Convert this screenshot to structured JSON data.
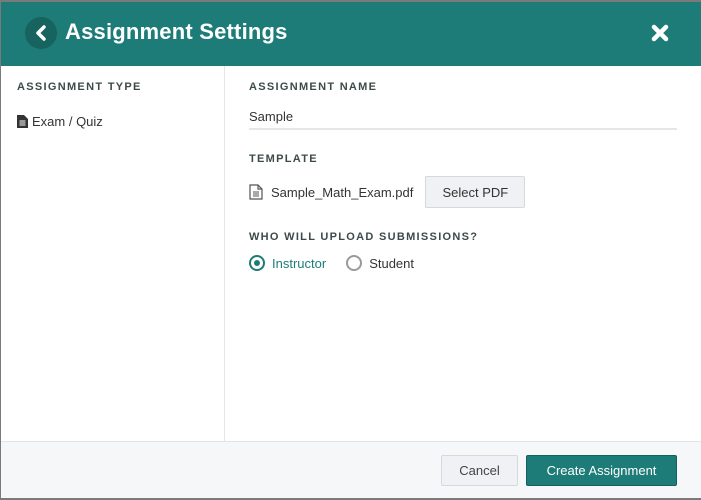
{
  "header": {
    "title": "Assignment Settings",
    "back_icon": "chevron-left-icon",
    "close_icon": "close-icon"
  },
  "sidebar": {
    "section_label": "ASSIGNMENT TYPE",
    "items": [
      {
        "label": "Exam / Quiz",
        "icon": "document-icon"
      }
    ]
  },
  "main": {
    "name_label": "ASSIGNMENT NAME",
    "name_value": "Sample",
    "template_label": "TEMPLATE",
    "template_file": "Sample_Math_Exam.pdf",
    "select_pdf_label": "Select PDF",
    "uploader_label": "WHO WILL UPLOAD SUBMISSIONS?",
    "uploader_options": [
      {
        "label": "Instructor",
        "selected": true
      },
      {
        "label": "Student",
        "selected": false
      }
    ]
  },
  "footer": {
    "cancel_label": "Cancel",
    "create_label": "Create Assignment"
  },
  "colors": {
    "brand": "#1d7c78",
    "brand_dark": "#16635f"
  }
}
